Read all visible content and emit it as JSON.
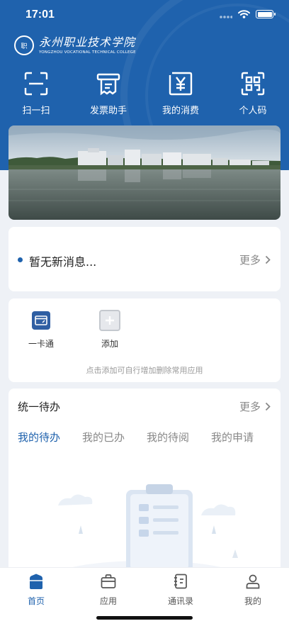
{
  "status_bar": {
    "time": "17:01"
  },
  "header": {
    "logo": {
      "cn": "永州职业技术学院",
      "en": "YONGZHOU VOCATIONAL TECHNICAL COLLEGE",
      "seal": "职"
    },
    "quick_actions": [
      {
        "label": "扫一扫",
        "icon": "scan-icon"
      },
      {
        "label": "发票助手",
        "icon": "invoice-icon"
      },
      {
        "label": "我的消费",
        "icon": "yuan-icon"
      },
      {
        "label": "个人码",
        "icon": "qr-code-icon"
      }
    ]
  },
  "news": {
    "text": "暂无新消息...",
    "more": "更多"
  },
  "apps": {
    "items": [
      {
        "label": "一卡通",
        "icon": "card-icon"
      },
      {
        "label": "添加",
        "icon": "add-icon"
      }
    ],
    "hint": "点击添加可自行增加删除常用应用"
  },
  "todo": {
    "title": "统一待办",
    "more": "更多",
    "tabs": [
      "我的待办",
      "我的已办",
      "我的待阅",
      "我的申请"
    ],
    "active_tab": 0
  },
  "bottom_nav": {
    "items": [
      {
        "label": "首页",
        "icon": "home-icon",
        "active": true
      },
      {
        "label": "应用",
        "icon": "briefcase-icon",
        "active": false
      },
      {
        "label": "通讯录",
        "icon": "contacts-icon",
        "active": false
      },
      {
        "label": "我的",
        "icon": "profile-icon",
        "active": false
      }
    ]
  },
  "colors": {
    "brand": "#1f62ad",
    "background": "#eef1f6",
    "muted": "#888888"
  }
}
